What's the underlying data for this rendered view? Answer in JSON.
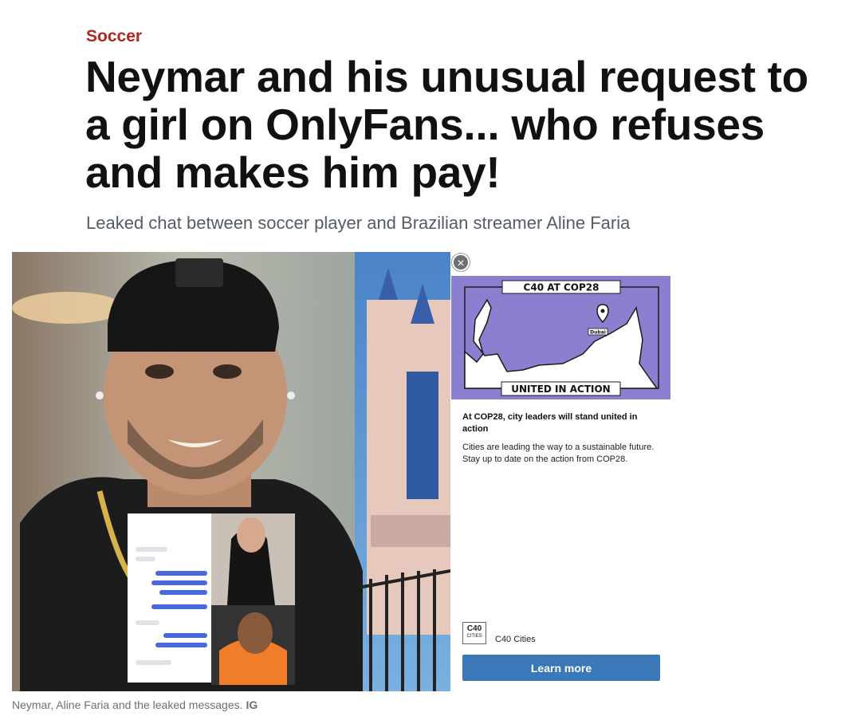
{
  "article": {
    "section": "Soccer",
    "headline": "Neymar and his unusual request to a girl on OnlyFans... who refuses and makes him pay!",
    "subhead": "Leaked chat between soccer player and Brazilian streamer Aline Faria"
  },
  "photo": {
    "caption": "Neymar, Aline Faria and the leaked messages.",
    "credit": "IG"
  },
  "ad": {
    "close_icon": "close-icon",
    "banner_top": "C40 AT COP28",
    "banner_bottom": "UNITED IN ACTION",
    "map_pin_label": "Dubai",
    "headline": "At COP28, city leaders will stand united in action",
    "body": "Cities are leading the way to a sustainable future. Stay up to date on the action from COP28.",
    "logo_line1": "C40",
    "logo_line2": "CITIES",
    "advertiser": "C40 Cities",
    "cta": "Learn more",
    "colors": {
      "panel": "#8b7fd0",
      "button": "#3a78b8"
    }
  },
  "colors": {
    "section": "#b3261e",
    "subhead": "#555c63",
    "caption": "#6f6f6f"
  }
}
